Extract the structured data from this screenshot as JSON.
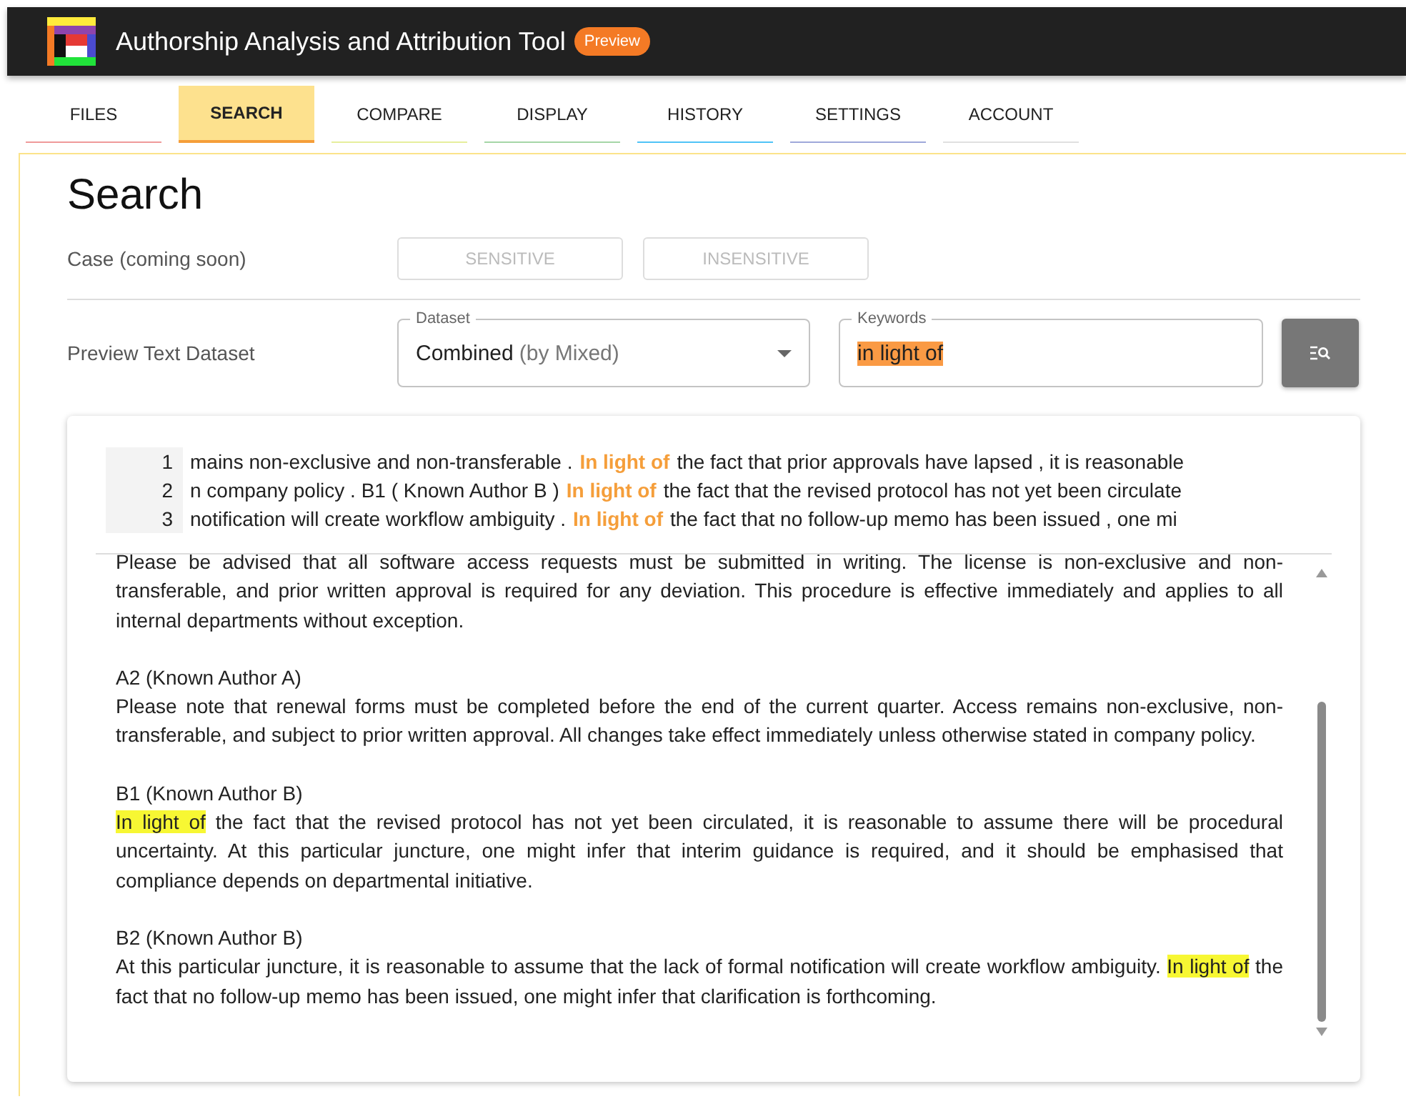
{
  "app": {
    "title": "Authorship Analysis and Attribution Tool",
    "badge": "Preview"
  },
  "tabs": [
    {
      "label": "FILES",
      "selected": false,
      "color": "#ef9a9a"
    },
    {
      "label": "SEARCH",
      "selected": true,
      "color": "#f59e3a"
    },
    {
      "label": "COMPARE",
      "selected": false,
      "color": "#e6ee9c"
    },
    {
      "label": "DISPLAY",
      "selected": false,
      "color": "#a5d6a7"
    },
    {
      "label": "HISTORY",
      "selected": false,
      "color": "#4fc3f7"
    },
    {
      "label": "SETTINGS",
      "selected": false,
      "color": "#9fa8da"
    },
    {
      "label": "ACCOUNT",
      "selected": false,
      "color": "#e0e0e0"
    }
  ],
  "search": {
    "heading": "Search",
    "case": {
      "label": "Case (coming soon)",
      "buttons": [
        {
          "label": "SENSITIVE",
          "disabled": true
        },
        {
          "label": "INSENSITIVE",
          "disabled": true
        }
      ]
    },
    "dataset_row": {
      "label": "Preview Text Dataset",
      "dataset": {
        "label": "Dataset",
        "value": "Combined",
        "detail": "(by Mixed)"
      },
      "keywords": {
        "label": "Keywords",
        "value": "in light of",
        "text_selected": true
      }
    }
  },
  "concordance": [
    {
      "number": "1",
      "left": "mains non-exclusive and non-transferable .",
      "match": "In light of",
      "right": "the fact that prior approvals have lapsed , it is reasonable"
    },
    {
      "number": "2",
      "left": "n company policy . B1 ( Known Author B )",
      "match": "In light of",
      "right": "the fact that the revised protocol has not yet been circulate"
    },
    {
      "number": "3",
      "left": "notification will create workflow ambiguity .",
      "match": "In light of",
      "right": "the fact that no follow-up memo has been issued , one mi"
    }
  ],
  "documents": [
    {
      "segments": [
        {
          "text": "Please be advised that all software access requests must be submitted in writing. The license is non-exclusive and non-transferable, and prior written approval is required for any deviation. This procedure is effective immediately and applies to all internal departments without exception.",
          "match": false
        }
      ]
    },
    {
      "heading": "A2 (Known Author A)",
      "segments": [
        {
          "text": "Please note that renewal forms must be completed before the end of the current quarter. Access remains non-exclusive, non-transferable, and subject to prior written approval. All changes take effect immediately unless otherwise stated in company policy.",
          "match": false
        }
      ]
    },
    {
      "heading": "B1 (Known Author B)",
      "segments": [
        {
          "text": "In light of",
          "match": true
        },
        {
          "text": " the fact that the revised protocol has not yet been circulated, it is reasonable to assume there will be procedural uncertainty. At this particular juncture, one might infer that interim guidance is required, and it should be emphasised that compliance depends on departmental initiative.",
          "match": false
        }
      ]
    },
    {
      "heading": "B2 (Known Author B)",
      "segments": [
        {
          "text": "At this particular juncture, it is reasonable to assume that the lack of formal notification will create workflow ambiguity. ",
          "match": false
        },
        {
          "text": "In light of",
          "match": true
        },
        {
          "text": " the fact that no follow-up memo has been issued, one might infer that clarification is forthcoming.",
          "match": false
        }
      ]
    }
  ]
}
